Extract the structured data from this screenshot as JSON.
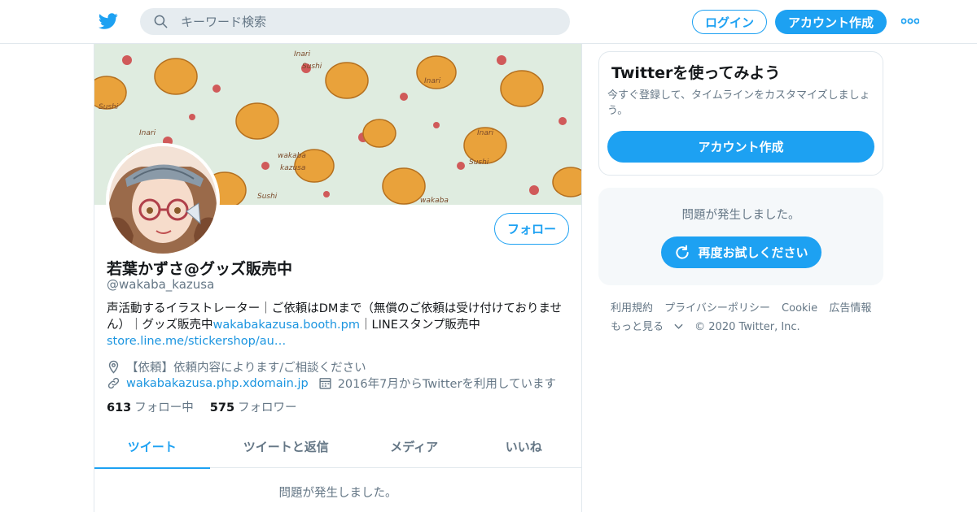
{
  "header": {
    "search_placeholder": "キーワード検索",
    "login_label": "ログイン",
    "signup_label": "アカウント作成"
  },
  "profile": {
    "display_name": "若葉かずさ@グッズ販売中",
    "handle": "@wakaba_kazusa",
    "follow_label": "フォロー",
    "bio_text_1": "声活動するイラストレーター｜ご依頼はDMまで（無償のご依頼は受け付けておりません）｜グッズ販売中",
    "bio_link_1": "wakabakazusa.booth.pm",
    "bio_text_2": "｜LINEスタンプ販売中",
    "bio_link_2": "store.line.me/stickershop/au…",
    "location": "【依頼】依頼内容によります/ご相談ください",
    "website": "wakabakazusa.php.xdomain.jp",
    "joined": "2016年7月からTwitterを利用しています",
    "following_count": "613",
    "following_label": "フォロー中",
    "followers_count": "575",
    "followers_label": "フォロワー"
  },
  "tabs": [
    {
      "label": "ツイート",
      "active": true
    },
    {
      "label": "ツイートと返信",
      "active": false
    },
    {
      "label": "メディア",
      "active": false
    },
    {
      "label": "いいね",
      "active": false
    }
  ],
  "timeline": {
    "error_text": "問題が発生しました。"
  },
  "sidebar": {
    "card_title": "Twitterを使ってみよう",
    "card_desc": "今すぐ登録して、タイムラインをカスタマイズしましょう。",
    "signup_label": "アカウント作成",
    "error_text": "問題が発生しました。",
    "retry_label": "再度お試しください"
  },
  "footer": {
    "terms": "利用規約",
    "privacy": "プライバシーポリシー",
    "cookie": "Cookie",
    "ads": "広告情報",
    "more": "もっと見る",
    "copyright": "© 2020 Twitter, Inc."
  },
  "banner_text": {
    "word_1": "Inari",
    "word_2": "Sushi",
    "word_3": "wakaba",
    "word_4": "kazusa"
  },
  "colors": {
    "accent": "#1da1f2",
    "link": "#1b95e0",
    "secondary_text": "#657786",
    "border": "#e1e8ed",
    "banner_bg": "#dfece0"
  },
  "icons": {
    "logo": "twitter-bird-icon",
    "search": "search-icon",
    "more": "more-dots-icon",
    "location": "location-pin-icon",
    "link": "link-icon",
    "calendar": "calendar-icon",
    "retry": "refresh-icon",
    "chevron": "chevron-down-icon"
  }
}
